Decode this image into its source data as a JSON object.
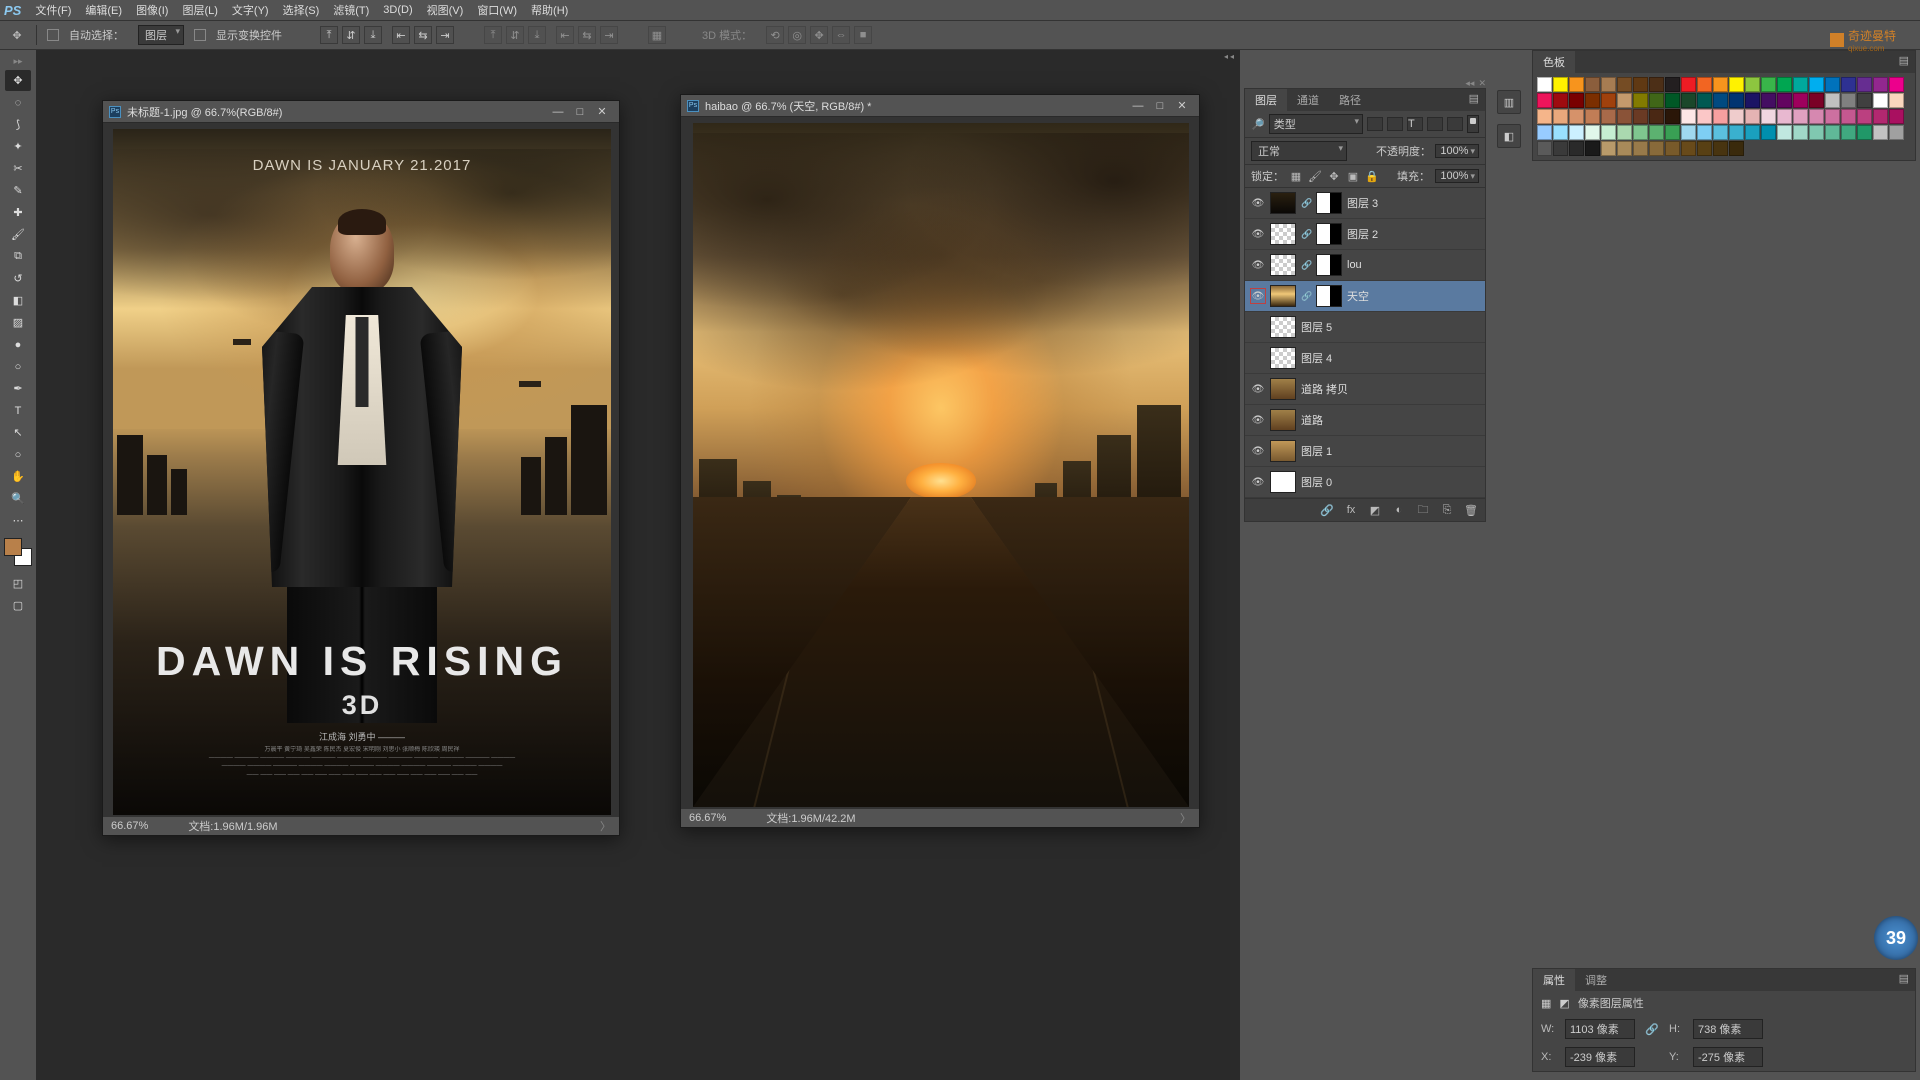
{
  "menu": {
    "logo": "PS",
    "items": [
      "文件(F)",
      "编辑(E)",
      "图像(I)",
      "图层(L)",
      "文字(Y)",
      "选择(S)",
      "滤镜(T)",
      "3D(D)",
      "视图(V)",
      "窗口(W)",
      "帮助(H)"
    ]
  },
  "options": {
    "auto_select": "自动选择：",
    "target": "图层",
    "show_transform": "显示变换控件",
    "mode3d": "3D 模式："
  },
  "brand": "奇迹曼特",
  "brand_sub": "qixue.com",
  "doc1": {
    "title": "未标题-1.jpg @ 66.7%(RGB/8#)",
    "zoom": "66.67%",
    "docinfo": "文档:1.96M/1.96M",
    "tagline": "DAWN IS JANUARY 21.2017",
    "title_big": "DAWN  IS  RISING",
    "sub3d": "3D",
    "credits_names": "江成海 刘勇中 ———",
    "credits_line1": "万晨平 黄宁琦 吴鑫荣    陈民杰 夏宏俊    宋明刚 刘思小 张顺梅    陈欣瑛 周民祥",
    "credits_line2": "———— ———— ———— ———— ———— ———— ———— ———— ———— ———— ———— ————",
    "credits_line3": "———— ———— ———— ———— ———— ———— ———— ———— ———— ———— ————",
    "credits_line4": "—— —— —— —— —— —— —— —— —— —— —— —— —— —— —— —— ——"
  },
  "doc2": {
    "title": "haibao @ 66.7% (天空, RGB/8#) *",
    "zoom": "66.67%",
    "docinfo": "文档:1.96M/42.2M"
  },
  "layers_panel": {
    "tabs": [
      "图层",
      "通道",
      "路径"
    ],
    "filter_label": "类型",
    "blend_mode": "正常",
    "opacity_label": "不透明度：",
    "opacity": "100%",
    "lock_label": "锁定：",
    "fill_label": "填充：",
    "fill": "100%",
    "layers": [
      {
        "name": "图层 3",
        "eye": true,
        "thumb": "dark",
        "mask": true,
        "link": true
      },
      {
        "name": "图层 2",
        "eye": true,
        "thumb": "checker",
        "mask": true,
        "link": true
      },
      {
        "name": "lou",
        "eye": true,
        "thumb": "checker",
        "mask": true,
        "link": true
      },
      {
        "name": "天空",
        "eye": true,
        "thumb": "img1",
        "mask": true,
        "link": true,
        "selected": true,
        "eyehl": true
      },
      {
        "name": "图层 5",
        "eye": false,
        "thumb": "checker",
        "mask": false,
        "link": false
      },
      {
        "name": "图层 4",
        "eye": false,
        "thumb": "checker",
        "mask": false,
        "link": false
      },
      {
        "name": "道路 拷贝",
        "eye": true,
        "thumb": "img2",
        "mask": false,
        "link": false
      },
      {
        "name": "道路",
        "eye": true,
        "thumb": "img2",
        "mask": false,
        "link": false
      },
      {
        "name": "图层 1",
        "eye": true,
        "thumb": "img3",
        "mask": false,
        "link": false
      },
      {
        "name": "图层 0",
        "eye": true,
        "thumb": "white",
        "mask": false,
        "link": false
      }
    ]
  },
  "swatches_panel": {
    "tab": "色板",
    "colors": [
      "#ffffff",
      "#fff200",
      "#f7941d",
      "#8b5e3c",
      "#a67c52",
      "#754c24",
      "#603913",
      "#4c2f17",
      "#231f20",
      "#ed1c24",
      "#f26522",
      "#f7941d",
      "#fff200",
      "#8dc63f",
      "#39b54a",
      "#00a651",
      "#00a99d",
      "#00aeef",
      "#0072bc",
      "#2e3192",
      "#662d91",
      "#92278f",
      "#ec008c",
      "#ed145b",
      "#9e0b0f",
      "#790000",
      "#7b2e00",
      "#a0410d",
      "#c49a6c",
      "#827b00",
      "#406618",
      "#005826",
      "#1a472a",
      "#005952",
      "#004a80",
      "#003471",
      "#1b1464",
      "#440e62",
      "#630460",
      "#9e005d",
      "#7a0026",
      "#c0c0c0",
      "#808080",
      "#404040",
      "#ffffff",
      "#f9d6bd",
      "#f5b58a",
      "#e8a87c",
      "#d6926a",
      "#c17d56",
      "#a86a4a",
      "#8a5338",
      "#6a3a24",
      "#4a2814",
      "#2a1608",
      "#fde6e6",
      "#fbc7c7",
      "#f7a0a0",
      "#efcccc",
      "#e5b3b3",
      "#f0d6e0",
      "#e8b8d0",
      "#dfa0c0",
      "#d688b0",
      "#cd70a0",
      "#c45890",
      "#bb4080",
      "#b22870",
      "#a91060",
      "#98ccff",
      "#99e0ff",
      "#ccf0ff",
      "#e0f7ea",
      "#c6eed2",
      "#aad9af",
      "#7fc68f",
      "#5cb270",
      "#39a054",
      "#a0d8ef",
      "#7ecef4",
      "#5bc0de",
      "#3ab0ce",
      "#1aa0be",
      "#008fae",
      "#c0e8e0",
      "#a0d8c8",
      "#80c8b0",
      "#60b898",
      "#40a880",
      "#209868",
      "#c2c2c2",
      "#a0a0a0",
      "#5a5a5a",
      "#3a3a3a",
      "#2a2a2a",
      "#1a1a1a",
      "#b89a6a",
      "#a88a5a",
      "#987a4a",
      "#886a3a",
      "#785a2a",
      "#684a1a",
      "#584014",
      "#483410",
      "#3a2a0c"
    ]
  },
  "props": {
    "tabs": [
      "属性",
      "调整"
    ],
    "title": "像素图层属性",
    "w_label": "W:",
    "w_val": "1103 像素",
    "h_label": "H:",
    "h_val": "738 像素",
    "x_label": "X:",
    "x_val": "-239 像素",
    "y_label": "Y:",
    "y_val": "-275 像素"
  },
  "badge": "39"
}
